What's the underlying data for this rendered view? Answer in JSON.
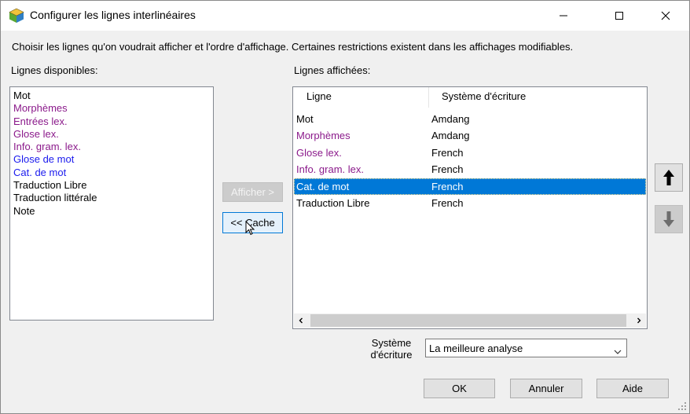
{
  "window": {
    "title": "Configurer les lignes interlinéaires"
  },
  "instructions": "Choisir les lignes qu'on voudrait afficher et l'ordre d'affichage. Certaines restrictions existent dans les affichages modifiables.",
  "available": {
    "label": "Lignes disponibles:",
    "items": [
      {
        "text": "Mot",
        "color": "#000000"
      },
      {
        "text": "Morphèmes",
        "color": "#8b1a8b"
      },
      {
        "text": "Entrées lex.",
        "color": "#8b1a8b"
      },
      {
        "text": "Glose lex.",
        "color": "#8b1a8b"
      },
      {
        "text": "Info. gram. lex.",
        "color": "#8b1a8b"
      },
      {
        "text": "Glose de mot",
        "color": "#1a1aee"
      },
      {
        "text": "Cat. de mot",
        "color": "#1a1aee"
      },
      {
        "text": "Traduction Libre",
        "color": "#000000"
      },
      {
        "text": "Traduction littérale",
        "color": "#000000"
      },
      {
        "text": "Note",
        "color": "#000000"
      }
    ]
  },
  "buttons": {
    "show": "Afficher >",
    "hide": "<< Cache",
    "ok": "OK",
    "cancel": "Annuler",
    "help": "Aide"
  },
  "displayed": {
    "label": "Lignes affichées:",
    "columns": [
      "Ligne",
      "Système d'écriture"
    ],
    "rows": [
      {
        "line": "Mot",
        "ws": "Amdang",
        "color": "#000000",
        "selected": false
      },
      {
        "line": "Morphèmes",
        "ws": "Amdang",
        "color": "#8b1a8b",
        "selected": false
      },
      {
        "line": "Glose lex.",
        "ws": "French",
        "color": "#8b1a8b",
        "selected": false
      },
      {
        "line": "Info. gram. lex.",
        "ws": "French",
        "color": "#8b1a8b",
        "selected": false
      },
      {
        "line": "Cat. de mot",
        "ws": "French",
        "color": "#1a1aee",
        "selected": true
      },
      {
        "line": "Traduction Libre",
        "ws": "French",
        "color": "#000000",
        "selected": false
      }
    ]
  },
  "writing_system": {
    "label_line1": "Système",
    "label_line2": "d'écriture",
    "value": "La meilleure analyse"
  },
  "icons": {
    "app": "app-cube-icon",
    "up": "arrow-up-icon",
    "down": "arrow-down-icon"
  },
  "colors": {
    "selection": "#0078d7",
    "purple_text": "#8b1a8b",
    "blue_text": "#1a1aee"
  }
}
